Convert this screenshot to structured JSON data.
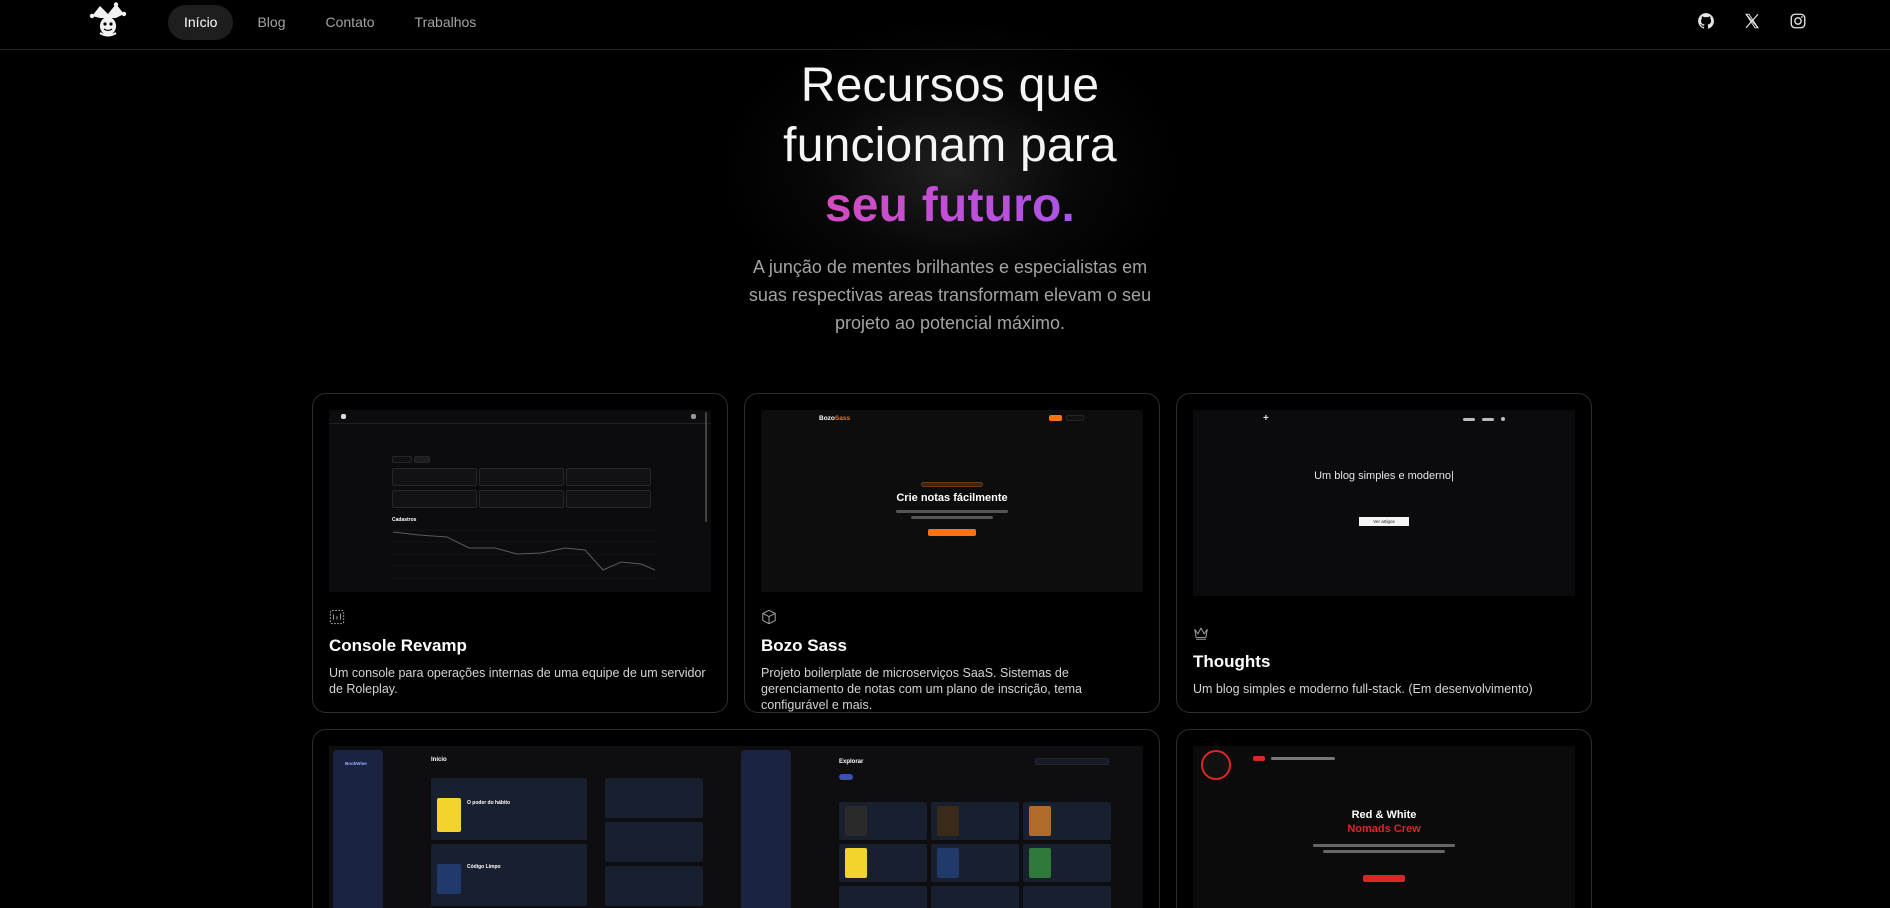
{
  "nav": {
    "links": [
      {
        "label": "Início",
        "active": true
      },
      {
        "label": "Blog",
        "active": false
      },
      {
        "label": "Contato",
        "active": false
      },
      {
        "label": "Trabalhos",
        "active": false
      }
    ],
    "social": [
      "github-icon",
      "x-icon",
      "instagram-icon"
    ]
  },
  "hero": {
    "title_line1": "Recursos que",
    "title_line2": "funcionam para",
    "title_accent": "seu futuro.",
    "subtitle": "A junção de mentes brilhantes e especialistas em suas respectivas areas transformam elevam o seu projeto ao potencial máximo."
  },
  "colors": {
    "background": "#000000",
    "accent_start": "#ec4899",
    "accent_end": "#8b5cf6",
    "bozo_orange": "#f97316",
    "red_white": "#dc2626"
  },
  "cards": [
    {
      "title": "Console Revamp",
      "description": "Um console para operações internas de uma equipe de um servidor de Roleplay.",
      "icon": "dashboard-icon",
      "preview": {
        "chart_title": "Cadastros"
      }
    },
    {
      "title": "Bozo Sass",
      "description": "Projeto boilerplate de microserviços SaaS. Sistemas de gerenciamento de notas com um plano de inscrição, tema configurável e mais.",
      "icon": "box-icon",
      "preview": {
        "brand_a": "Bozo",
        "brand_b": "Sass",
        "heading": "Crie notas fácilmente"
      }
    },
    {
      "title": "Thoughts",
      "description": "Um blog simples e moderno full-stack. (Em desenvolvimento)",
      "icon": "crown-icon",
      "preview": {
        "tagline": "Um blog simples e moderno|",
        "button": "Ver artigos"
      }
    },
    {
      "preview": {
        "brand": "BookWise",
        "section_a": "Início",
        "section_b": "Explorar",
        "book_1": "O poder do hábito",
        "book_2": "Código Limpo"
      }
    },
    {
      "preview": {
        "heading_a": "Red & White",
        "heading_b": "Nomads Crew"
      }
    }
  ]
}
